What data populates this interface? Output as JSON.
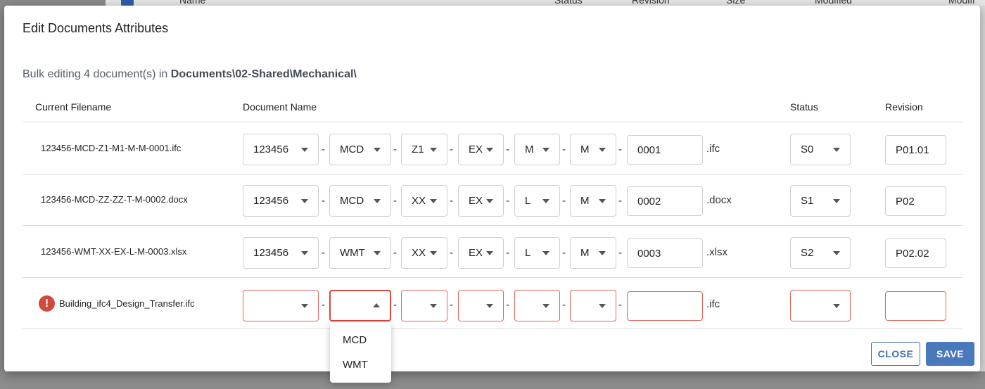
{
  "background": {
    "columns": [
      "Name",
      "Status",
      "Revision",
      "Size",
      "Modified",
      "Modifi"
    ]
  },
  "dialog": {
    "title": "Edit Documents Attributes",
    "subtitle_prefix": "Bulk editing 4 document(s) in ",
    "subtitle_path": "Documents\\02-Shared\\Mechanical\\",
    "headers": {
      "current_filename": "Current Filename",
      "document_name": "Document Name",
      "status": "Status",
      "revision": "Revision"
    },
    "rows": [
      {
        "filename": "123456-MCD-Z1-M1-M-M-0001.ifc",
        "f1": "123456",
        "f2": "MCD",
        "f3": "Z1",
        "f4": "EX",
        "f5": "M",
        "f6": "M",
        "number": "0001",
        "ext": ".ifc",
        "status": "S0",
        "revision": "P01.01"
      },
      {
        "filename": "123456-MCD-ZZ-ZZ-T-M-0002.docx",
        "f1": "123456",
        "f2": "MCD",
        "f3": "XX",
        "f4": "EX",
        "f5": "L",
        "f6": "M",
        "number": "0002",
        "ext": ".docx",
        "status": "S1",
        "revision": "P02"
      },
      {
        "filename": "123456-WMT-XX-EX-L-M-0003.xlsx",
        "f1": "123456",
        "f2": "WMT",
        "f3": "XX",
        "f4": "EX",
        "f5": "L",
        "f6": "M",
        "number": "0003",
        "ext": ".xlsx",
        "status": "S2",
        "revision": "P02.02"
      },
      {
        "filename": "Building_ifc4_Design_Transfer.ifc",
        "f1": "",
        "f2": "",
        "f3": "",
        "f4": "",
        "f5": "",
        "f6": "",
        "number": "",
        "ext": ".ifc",
        "status": "",
        "revision": ""
      }
    ],
    "dash": "-",
    "error_icon_glyph": "!",
    "dropdown_options": [
      "MCD",
      "WMT"
    ],
    "buttons": {
      "close": "CLOSE",
      "save": "SAVE"
    }
  },
  "colors": {
    "primary": "#4a78bd",
    "error": "#d04b3c"
  }
}
